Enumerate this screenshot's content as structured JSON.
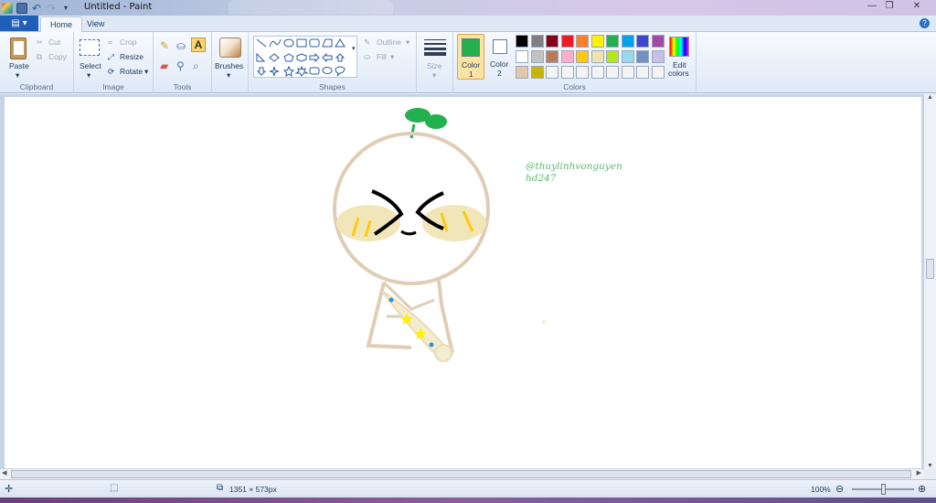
{
  "app": {
    "title": "Untitled - Paint",
    "app_menu_icon": "paint-menu-icon"
  },
  "tabs": [
    {
      "label": "Home",
      "active": true
    },
    {
      "label": "View",
      "active": false
    }
  ],
  "ribbon": {
    "clipboard": {
      "group_label": "Clipboard",
      "paste": "Paste",
      "cut": "Cut",
      "copy": "Copy"
    },
    "image": {
      "group_label": "Image",
      "select": "Select",
      "crop": "Crop",
      "resize": "Resize",
      "rotate": "Rotate"
    },
    "tools": {
      "group_label": "Tools"
    },
    "brushes": {
      "label": "Brushes"
    },
    "shapes": {
      "group_label": "Shapes",
      "outline": "Outline",
      "fill": "Fill"
    },
    "size": {
      "label": "Size"
    },
    "colors": {
      "group_label": "Colors",
      "color1": {
        "line1": "Color",
        "line2": "1",
        "value": "#22b14c"
      },
      "color2": {
        "line1": "Color",
        "line2": "2",
        "value": "#ffffff"
      },
      "edit": {
        "line1": "Edit",
        "line2": "colors"
      },
      "palette_row1": [
        "#000000",
        "#7f7f7f",
        "#880015",
        "#ed1c24",
        "#ff7f27",
        "#fff200",
        "#22b14c",
        "#00a2e8",
        "#3f48cc",
        "#a349a4"
      ],
      "palette_row2": [
        "#ffffff",
        "#c3c3c3",
        "#b97a57",
        "#ffaec9",
        "#ffc90e",
        "#efe4b0",
        "#b5e61d",
        "#99d9ea",
        "#7092be",
        "#c8bfe7"
      ],
      "palette_row3": [
        "#e0c8a8",
        "#c9b400",
        "#f4f4f4",
        "#f4f4f4",
        "#f4f4f4",
        "#f4f4f4",
        "#f4f4f4",
        "#f4f4f4",
        "#f4f4f4",
        "#f4f4f4"
      ]
    }
  },
  "canvas": {
    "signature_line1": "@thuylinhvonguyen",
    "signature_line2": "hd247"
  },
  "status": {
    "dimensions": "1351 × 573px",
    "zoom": "100%"
  }
}
